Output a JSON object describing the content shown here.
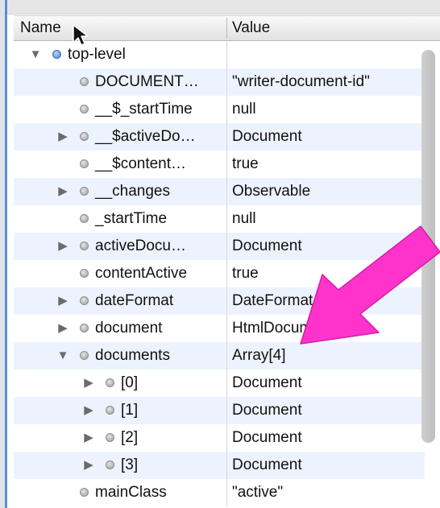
{
  "columns": {
    "name": "Name",
    "value": "Value"
  },
  "colors": {
    "arrow": "#ff33cc",
    "selection_dot": "#4c81d8",
    "alt_row": "#edf3fe"
  },
  "rows": [
    {
      "name": "top-level",
      "value": "",
      "depth": 0,
      "expander": "expanded",
      "dot": "blue"
    },
    {
      "name": "DOCUMENT…",
      "value": "\"writer-document-id\"",
      "depth": 1,
      "expander": "none",
      "dot": "gray"
    },
    {
      "name": "__$_startTime",
      "value": "null",
      "depth": 1,
      "expander": "none",
      "dot": "gray"
    },
    {
      "name": "__$activeDo…",
      "value": "Document",
      "depth": 1,
      "expander": "collapsed",
      "dot": "gray"
    },
    {
      "name": "__$content…",
      "value": "true",
      "depth": 1,
      "expander": "none",
      "dot": "gray"
    },
    {
      "name": "__changes",
      "value": "Observable",
      "depth": 1,
      "expander": "collapsed",
      "dot": "gray"
    },
    {
      "name": "_startTime",
      "value": "null",
      "depth": 1,
      "expander": "none",
      "dot": "gray"
    },
    {
      "name": "activeDocu…",
      "value": "Document",
      "depth": 1,
      "expander": "collapsed",
      "dot": "gray"
    },
    {
      "name": "contentActive",
      "value": "true",
      "depth": 1,
      "expander": "none",
      "dot": "gray"
    },
    {
      "name": "dateFormat",
      "value": "DateFormat",
      "depth": 1,
      "expander": "collapsed",
      "dot": "gray"
    },
    {
      "name": "document",
      "value": "HtmlDocument",
      "depth": 1,
      "expander": "collapsed",
      "dot": "gray"
    },
    {
      "name": "documents",
      "value": "Array[4]",
      "depth": 1,
      "expander": "expanded",
      "dot": "gray"
    },
    {
      "name": "[0]",
      "value": "Document",
      "depth": 2,
      "expander": "collapsed",
      "dot": "gray"
    },
    {
      "name": "[1]",
      "value": "Document",
      "depth": 2,
      "expander": "collapsed",
      "dot": "gray"
    },
    {
      "name": "[2]",
      "value": "Document",
      "depth": 2,
      "expander": "collapsed",
      "dot": "gray"
    },
    {
      "name": "[3]",
      "value": "Document",
      "depth": 2,
      "expander": "collapsed",
      "dot": "gray"
    },
    {
      "name": "mainClass",
      "value": "\"active\"",
      "depth": 1,
      "expander": "none",
      "dot": "gray"
    }
  ]
}
